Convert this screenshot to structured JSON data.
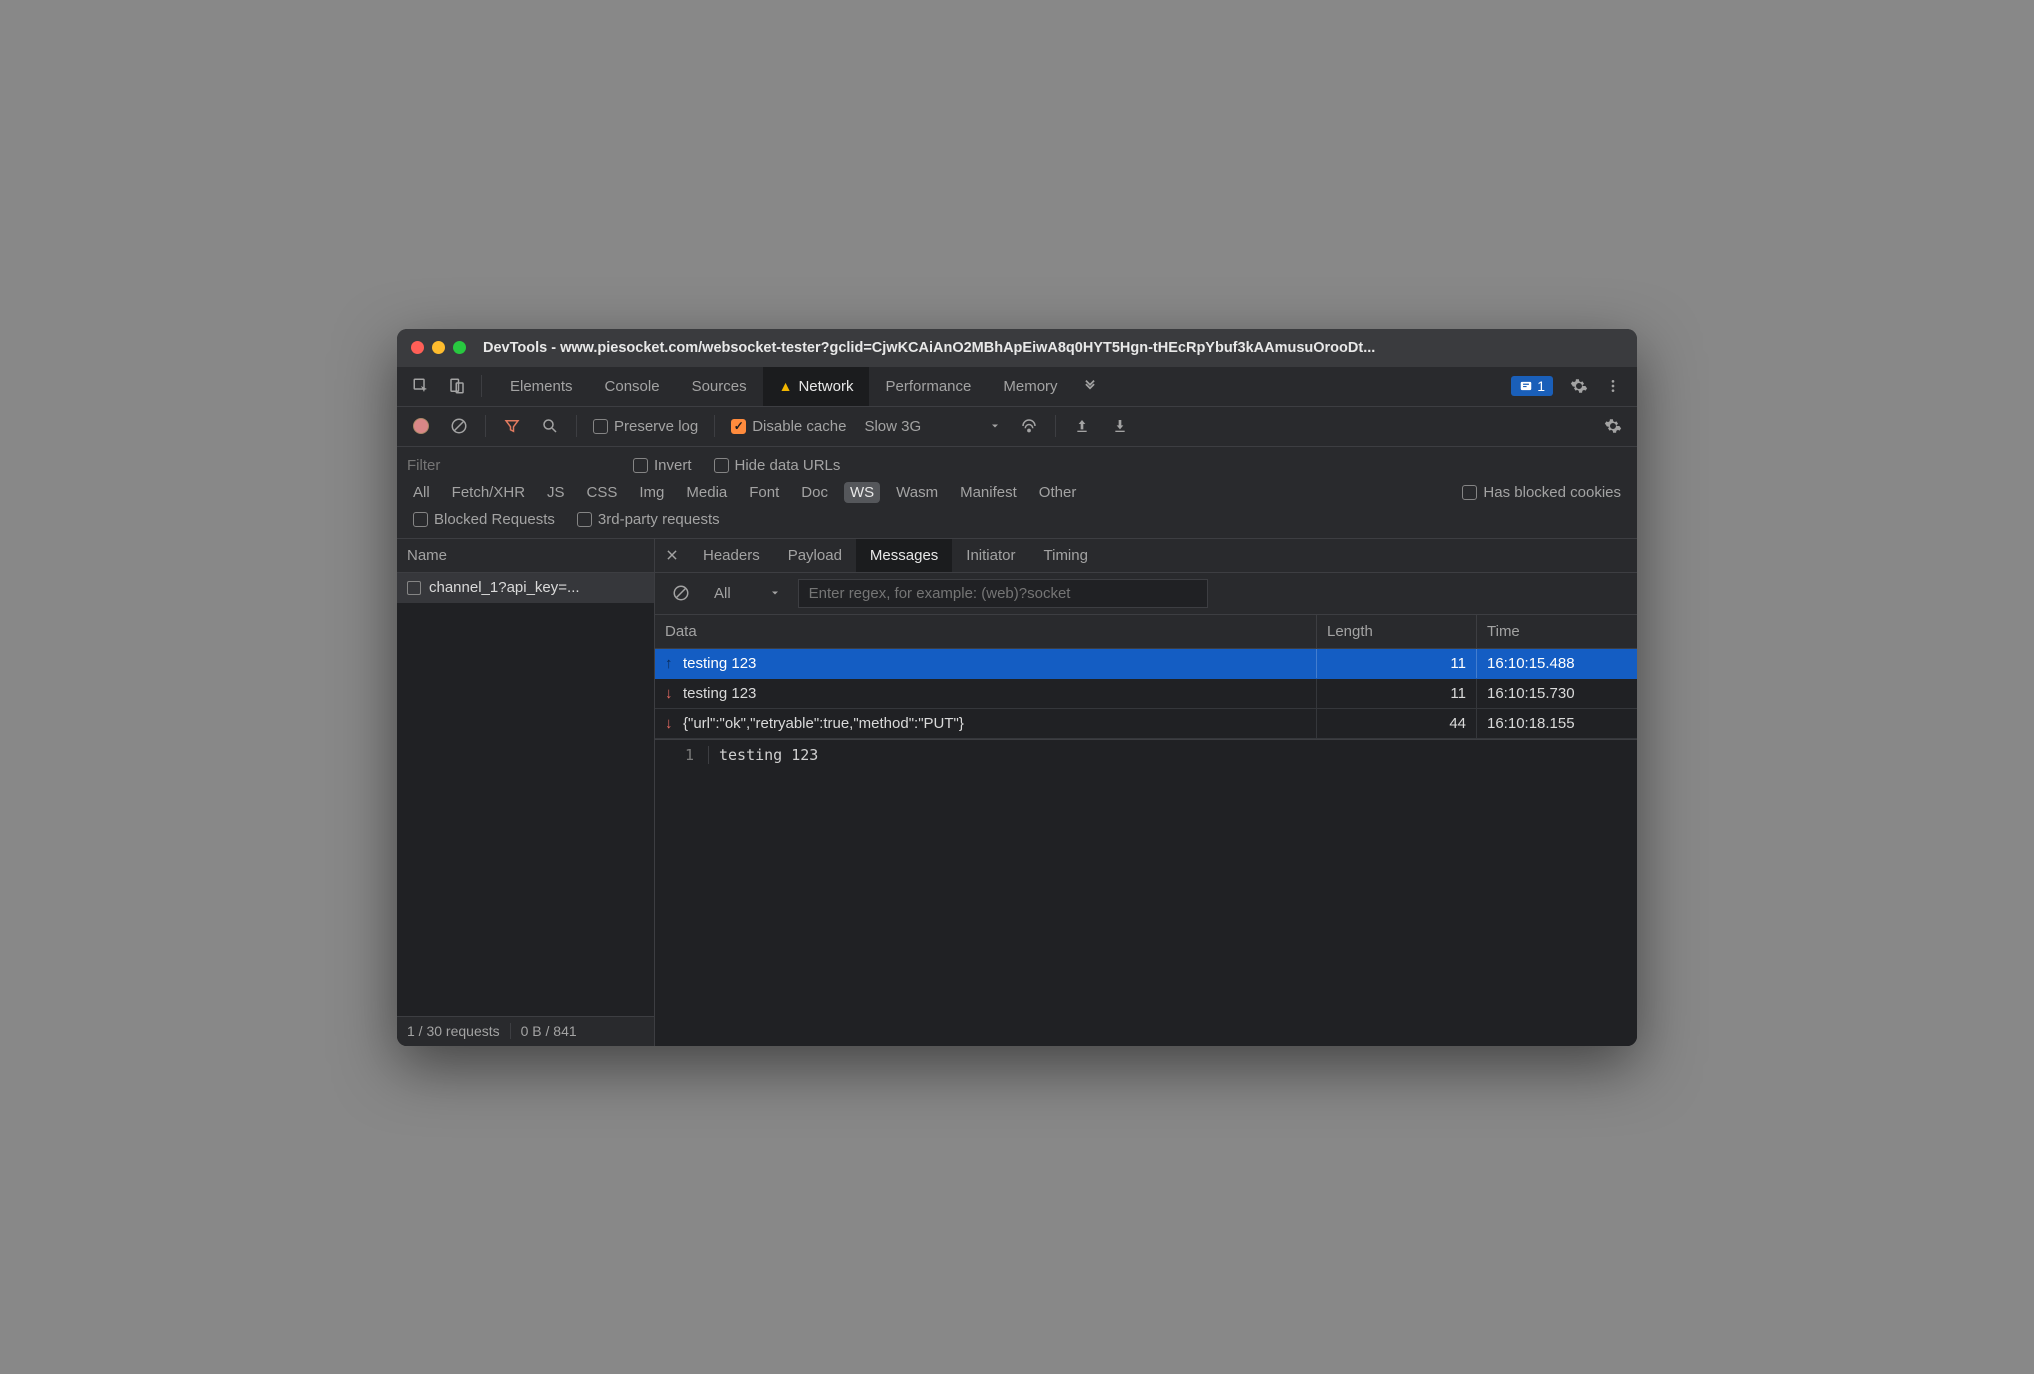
{
  "window": {
    "title": "DevTools - www.piesocket.com/websocket-tester?gclid=CjwKCAiAnO2MBhApEiwA8q0HYT5Hgn-tHEcRpYbuf3kAAmusuOrooDt..."
  },
  "tabs": {
    "items": [
      {
        "label": "Elements"
      },
      {
        "label": "Console"
      },
      {
        "label": "Sources"
      },
      {
        "label": "Network",
        "active": true,
        "warn": true
      },
      {
        "label": "Performance"
      },
      {
        "label": "Memory"
      }
    ],
    "issues_count": "1"
  },
  "toolbar": {
    "preserve_log": "Preserve log",
    "disable_cache": "Disable cache",
    "throttling": "Slow 3G"
  },
  "filters": {
    "placeholder": "Filter",
    "invert": "Invert",
    "hide_data_urls": "Hide data URLs",
    "types": [
      "All",
      "Fetch/XHR",
      "JS",
      "CSS",
      "Img",
      "Media",
      "Font",
      "Doc",
      "WS",
      "Wasm",
      "Manifest",
      "Other"
    ],
    "active_type": "WS",
    "has_blocked_cookies": "Has blocked cookies",
    "blocked_requests": "Blocked Requests",
    "third_party": "3rd-party requests"
  },
  "requests": {
    "header": "Name",
    "items": [
      {
        "name": "channel_1?api_key=..."
      }
    ],
    "status_left": "1 / 30 requests",
    "status_right": "0 B / 841"
  },
  "detail": {
    "tabs": [
      "Headers",
      "Payload",
      "Messages",
      "Initiator",
      "Timing"
    ],
    "active_tab": "Messages",
    "filter_all": "All",
    "regex_placeholder": "Enter regex, for example: (web)?socket",
    "columns": {
      "data": "Data",
      "length": "Length",
      "time": "Time"
    },
    "messages": [
      {
        "dir": "up",
        "data": "testing 123",
        "length": "11",
        "time": "16:10:15.488",
        "selected": true
      },
      {
        "dir": "down",
        "data": "testing 123",
        "length": "11",
        "time": "16:10:15.730"
      },
      {
        "dir": "down",
        "data": "{\"url\":\"ok\",\"retryable\":true,\"method\":\"PUT\"}",
        "length": "44",
        "time": "16:10:18.155"
      }
    ],
    "preview": {
      "line_no": "1",
      "text": "testing 123"
    }
  }
}
